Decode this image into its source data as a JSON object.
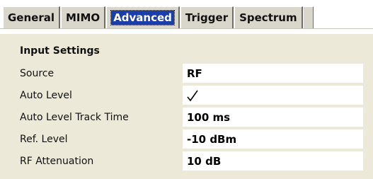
{
  "tabs": [
    {
      "label": "General",
      "active": false
    },
    {
      "label": "MIMO",
      "active": false
    },
    {
      "label": "Advanced",
      "active": true
    },
    {
      "label": "Trigger",
      "active": false
    },
    {
      "label": "Spectrum",
      "active": false
    }
  ],
  "section": {
    "title": "Input Settings"
  },
  "fields": {
    "source": {
      "label": "Source",
      "value": "RF"
    },
    "auto_level": {
      "label": "Auto Level",
      "checked": true,
      "icon": "checkmark-icon"
    },
    "auto_level_track_time": {
      "label": "Auto Level Track Time",
      "value": "100 ms"
    },
    "ref_level": {
      "label": "Ref. Level",
      "value": "-10 dBm"
    },
    "rf_attenuation": {
      "label": "RF Attenuation",
      "value": "10 dB"
    }
  },
  "colors": {
    "active_tab_bg": "#1c3ea8",
    "panel_bg": "#ece9d8",
    "field_bg": "#ffffff"
  }
}
